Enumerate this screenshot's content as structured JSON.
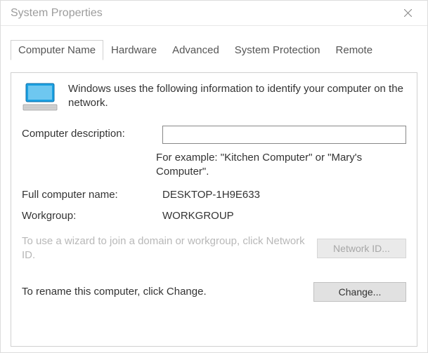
{
  "window": {
    "title": "System Properties"
  },
  "tabs": {
    "t0": "Computer Name",
    "t1": "Hardware",
    "t2": "Advanced",
    "t3": "System Protection",
    "t4": "Remote"
  },
  "intro": "Windows uses the following information to identify your computer on the network.",
  "labels": {
    "description": "Computer description:",
    "example": "For example: \"Kitchen Computer\" or \"Mary's Computer\".",
    "fullname": "Full computer name:",
    "workgroup": "Workgroup:"
  },
  "values": {
    "description": "",
    "fullname": "DESKTOP-1H9E633",
    "workgroup": "WORKGROUP"
  },
  "wizard": {
    "text": "To use a wizard to join a domain or workgroup, click Network ID.",
    "button": "Network ID..."
  },
  "rename": {
    "text": "To rename this computer, click Change.",
    "button": "Change..."
  }
}
